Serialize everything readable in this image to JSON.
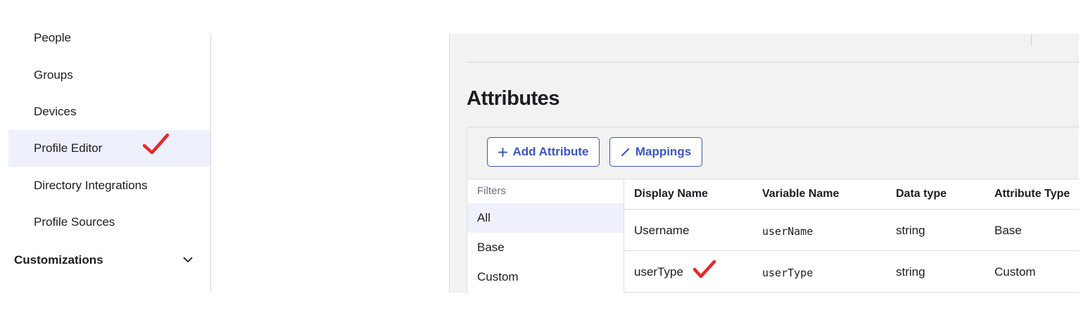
{
  "sidebar": {
    "items": [
      {
        "label": "People"
      },
      {
        "label": "Groups"
      },
      {
        "label": "Devices"
      },
      {
        "label": "Profile Editor"
      },
      {
        "label": "Directory Integrations"
      },
      {
        "label": "Profile Sources"
      }
    ],
    "section": {
      "label": "Customizations"
    }
  },
  "main": {
    "heading": "Attributes",
    "buttons": {
      "add_attribute": "Add Attribute",
      "mappings": "Mappings"
    },
    "filters": {
      "title": "Filters",
      "items": [
        {
          "label": "All"
        },
        {
          "label": "Base"
        },
        {
          "label": "Custom"
        }
      ]
    },
    "table": {
      "columns": [
        "Display Name",
        "Variable Name",
        "Data type",
        "Attribute Type"
      ],
      "rows": [
        {
          "display_name": "Username",
          "variable_name": "userName",
          "data_type": "string",
          "attribute_type": "Base"
        },
        {
          "display_name": "userType",
          "variable_name": "userType",
          "data_type": "string",
          "attribute_type": "Custom"
        }
      ]
    }
  },
  "colors": {
    "accent": "#3b56c7",
    "active_bg": "#eef0fb",
    "panel_bg": "#f2f2f3",
    "annotation_check": "#e8262b"
  },
  "icons": [
    "chevron-down-icon",
    "plus-icon",
    "pencil-icon",
    "checkmark-annotation-icon"
  ]
}
